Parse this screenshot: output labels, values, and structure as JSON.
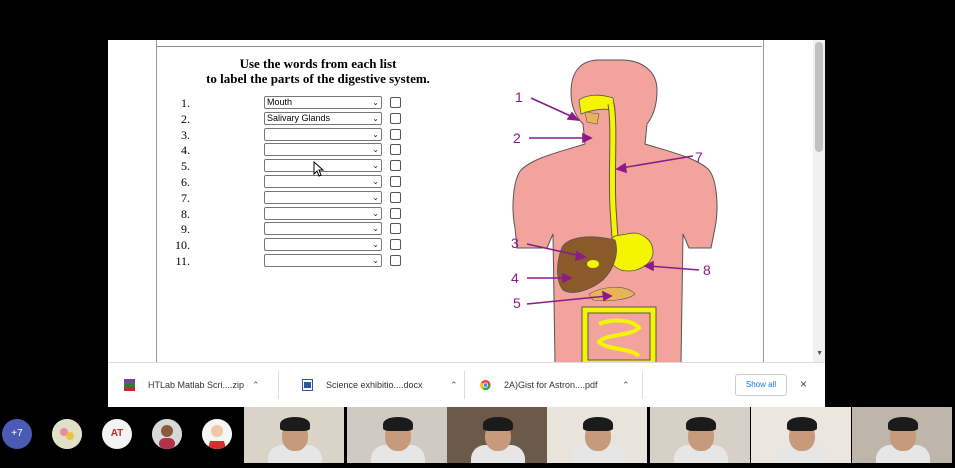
{
  "worksheet": {
    "title_line1": "Use the words from each list",
    "title_line2": "to label the parts of the digestive system.",
    "rows": [
      {
        "number": "1.",
        "value": "Mouth"
      },
      {
        "number": "2.",
        "value": "Salivary Glands"
      },
      {
        "number": "3.",
        "value": ""
      },
      {
        "number": "4.",
        "value": ""
      },
      {
        "number": "5.",
        "value": ""
      },
      {
        "number": "6.",
        "value": ""
      },
      {
        "number": "7.",
        "value": ""
      },
      {
        "number": "8.",
        "value": ""
      },
      {
        "number": "9.",
        "value": ""
      },
      {
        "number": "10.",
        "value": ""
      },
      {
        "number": "11.",
        "value": ""
      }
    ]
  },
  "diagram": {
    "labels": [
      "1",
      "2",
      "3",
      "4",
      "5",
      "7",
      "8"
    ],
    "colors": {
      "body": "#f2a49c",
      "tract": "#f5f500",
      "liver": "#8b5a2b",
      "arrow": "#8b1a8b",
      "outline": "#555555"
    }
  },
  "downloads": [
    {
      "name": "HTLab Matlab Scri....zip",
      "icon": "zip-archive-icon"
    },
    {
      "name": "Science exhibitio....docx",
      "icon": "word-document-icon"
    },
    {
      "name": "2A)Gist  for Astron....pdf",
      "icon": "chrome-pdf-icon"
    }
  ],
  "shelf": {
    "show_all": "Show all",
    "close": "×"
  },
  "meeting": {
    "more_count": "+7",
    "avatar_initials": "AT"
  }
}
